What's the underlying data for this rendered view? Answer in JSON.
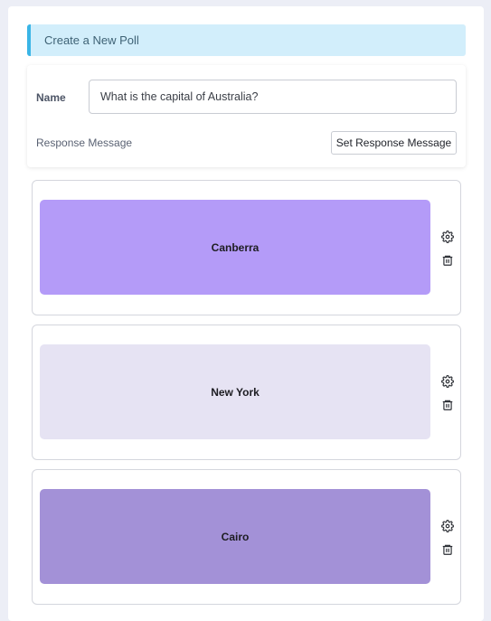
{
  "banner": {
    "title": "Create a New Poll"
  },
  "form": {
    "name_label": "Name",
    "name_value": "What is the capital of Australia?",
    "response_label": "Response Message",
    "response_button": "Set Response Message"
  },
  "options": [
    {
      "label": "Canberra",
      "color": "#b49bf8"
    },
    {
      "label": "New York",
      "color": "#e6e3f3"
    },
    {
      "label": "Cairo",
      "color": "#a391d7"
    }
  ],
  "icons": {
    "settings": "gear-icon",
    "delete": "trash-icon"
  }
}
